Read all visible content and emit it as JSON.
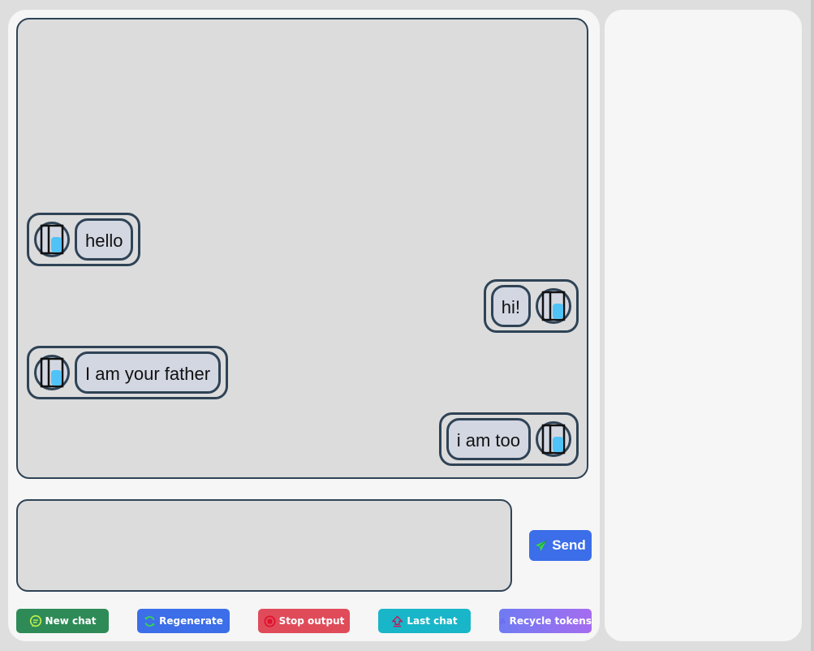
{
  "chat": {
    "messages": [
      {
        "role": "user",
        "text": "hello"
      },
      {
        "role": "assistant",
        "text": "hi!"
      },
      {
        "role": "user",
        "text": "I am your father"
      },
      {
        "role": "assistant",
        "text": "i am too"
      }
    ]
  },
  "input": {
    "placeholder": ""
  },
  "send": {
    "label": "Send",
    "icon": "paper-plane-icon"
  },
  "toolbar": {
    "new_chat": {
      "label": "New chat",
      "icon": "chat-bubble-icon",
      "color": "#2e8b57"
    },
    "regenerate": {
      "label": "Regenerate",
      "icon": "refresh-icon",
      "color": "#3b6ee8"
    },
    "stop_output": {
      "label": "Stop output",
      "icon": "stop-circle-icon",
      "color": "#e04b5a"
    },
    "last_chat": {
      "label": "Last chat",
      "icon": "upload-arrow-icon",
      "color": "#19b6c9"
    },
    "recycle_tokens": {
      "label": "Recycle tokens",
      "icon": "recycle-icon",
      "color_from": "#6f7bf2",
      "color_to": "#a56cf0"
    }
  },
  "colors": {
    "border": "#2f4356",
    "bubble": "#d3d7e2",
    "chat_bg": "#dcdcdc",
    "panel_bg": "#f6f6f6",
    "avatar_accent": "#4fc3f7"
  }
}
